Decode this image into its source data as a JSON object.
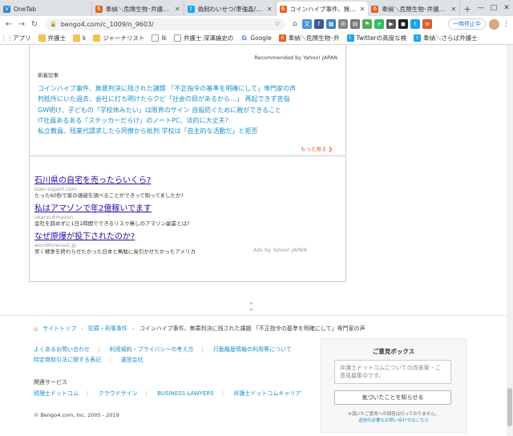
{
  "browser": {
    "tabs": [
      {
        "title": "OneTab",
        "icon": "onetab-icon",
        "color": "#3b82c4",
        "active": false
      },
      {
        "title": "奉納＼危険生物･弁護士ドット",
        "icon": "bengo4-icon",
        "color": "#e0621c",
        "active": false
      },
      {
        "title": "偽制わいせつ/準強姦/窃盗",
        "icon": "twitter-icon",
        "color": "#1da1f2",
        "active": false
      },
      {
        "title": "コインハイブ事件、無罪判決",
        "icon": "bengo4-icon",
        "color": "#e0621c",
        "active": true
      },
      {
        "title": "奉納＼危険生物･弁護士ドット",
        "icon": "bengo4-icon",
        "color": "#e0621c",
        "active": false
      }
    ],
    "new_tab": "+",
    "url": "bengo4.com/c_1009/n_9603/",
    "paused_label": "一時停止中",
    "bookmarks": [
      {
        "label": "アプリ",
        "icon": "apps-icon"
      },
      {
        "label": "弁護士",
        "icon": "folder-icon"
      },
      {
        "label": "k",
        "icon": "folder-icon"
      },
      {
        "label": "ジャーナリスト",
        "icon": "folder-icon"
      },
      {
        "label": "lk",
        "icon": "file-icon"
      },
      {
        "label": "弁護士 深澤論史の",
        "icon": "file-icon"
      },
      {
        "label": "Google",
        "icon": "google-icon"
      },
      {
        "label": "奉納＼危険生物･弁",
        "icon": "bengo4-icon"
      },
      {
        "label": "Twitterの高度な検",
        "icon": "twitter-icon"
      },
      {
        "label": "奉納＼さらば弁護士",
        "icon": "twitter-icon"
      }
    ]
  },
  "recommend": {
    "by": "Recommended by Yahoo! JAPAN",
    "heading": "新着記事",
    "items": [
      "コインハイブ事件、無罪判決に残された課題 「不正指令の基準を明確にして」専門家の声",
      "判抵所にいた過去、会社に打ち明けたらクビ「社会の目があるから…」 再起できず苦悩",
      "GW明け、子どもの「学校休みたい」は限界のサイン 自殺防ぐために親ができること",
      "IT社員あるある「ステッカーだらけ」のノートPC、法的に大丈夫?",
      "私立教員、残業代請求したら同僚から批判 学校は「自主的な活動だ」と拒否"
    ],
    "more": "もっと見る"
  },
  "ads": {
    "items": [
      {
        "title": "石川県の自宅を売ったらいくら?",
        "url": "loan-suport.com",
        "desc": "たった60秒で家の価値を調べることができって知ってましたか?"
      },
      {
        "title": "私はアマゾンで年2億稼いでます",
        "url": "ukano.Amazon",
        "desc": "会社を辞めずに1日1時間でできるリスク無しのアマゾン副業とは?"
      },
      {
        "title": "なぜ原爆が投下されたのか?",
        "url": "worldforecast.jp",
        "desc": "早く戦争を終わらせたかった日本と無駄に長引かせたかったアメリカ"
      }
    ],
    "by": "Ads by Yahoo! JAPAN"
  },
  "footer": {
    "breadcrumb": [
      "サイトトップ",
      "犯罪・刑事事件",
      "コインハイブ事件、無罪判決に残された課題 「不正指令の基準を明確にして」専門家の声"
    ],
    "links_row1": [
      "よくあるお問い合わせ",
      "利用規約・プライバシーの考え方",
      "行動履歴情報の利用等について"
    ],
    "links_row2": [
      "特定商取引法に関する表記",
      "運営会社"
    ],
    "related_heading": "関連サービス",
    "services": [
      "税理士ドットコム",
      "クラウドサイン",
      "BUSINESS LAWYERS",
      "弁護士ドットコムキャリア"
    ],
    "copyright": "© Bengo4.com, Inc. 2005 - 2019",
    "feedback": {
      "title": "ご意見ボックス",
      "placeholder": "弁護士ドットコムについての改善案・ご意見募集中です。",
      "button": "気づいたことを知らせる",
      "note": "※頂いたご意見への回答は行っておりません。",
      "link": "返信の必要なお問い合わせはこちら"
    }
  }
}
